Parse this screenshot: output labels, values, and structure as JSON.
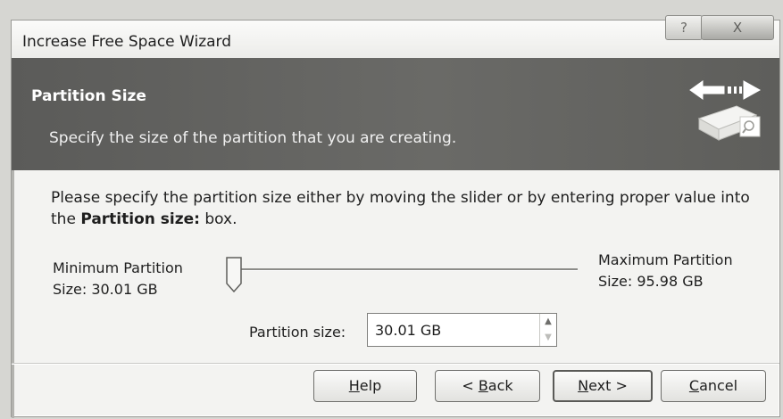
{
  "window": {
    "title": "Increase Free Space Wizard",
    "help_caption": "?",
    "close_caption": "X"
  },
  "header": {
    "title": "Partition Size",
    "subtitle": "Specify the size of the partition that you are creating.",
    "icon": "disk-resize-icon"
  },
  "content": {
    "instruction_before": "Please specify the partition size either by moving the slider or by entering proper value into the ",
    "instruction_bold": "Partition size:",
    "instruction_after": " box.",
    "min_label_line1": "Minimum Partition",
    "min_label_line2": "Size: 30.01 GB",
    "max_label_line1": "Maximum Partition",
    "max_label_line2": "Size: 95.98 GB",
    "slider_position": 0,
    "partition_size_label": "Partition size:",
    "partition_size_value": "30.01 GB"
  },
  "buttons": {
    "help_pre": "",
    "help_key": "H",
    "help_post": "elp",
    "back_pre": "< ",
    "back_key": "B",
    "back_post": "ack",
    "next_pre": "",
    "next_key": "N",
    "next_post": "ext >",
    "cancel_pre": "",
    "cancel_key": "C",
    "cancel_post": "ancel"
  }
}
